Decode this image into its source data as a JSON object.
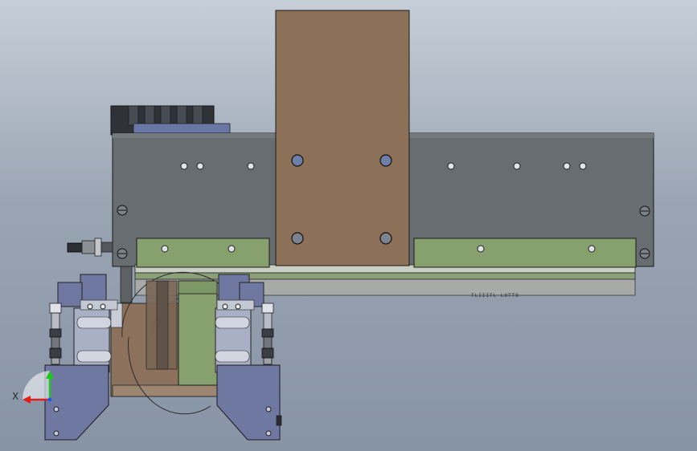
{
  "viewport": {
    "background_top": "#c6ced8",
    "background_bottom": "#8794a6"
  },
  "colors": {
    "carriage_plate": "#8c7058",
    "base_plate": "#676d71",
    "rail_guides": "#86a06e",
    "rail_bar": "#b7bdb2",
    "gripper_frame": "#6f78a0",
    "gripper_slide": "#a9afc4",
    "motor": "#2f3338",
    "outline": "#1a1a1a"
  },
  "triad": {
    "x_label": "X",
    "x_color": "#e01e1e",
    "y_color": "#1ec81e"
  },
  "rail_text": "TLIIITL   LOTTD"
}
